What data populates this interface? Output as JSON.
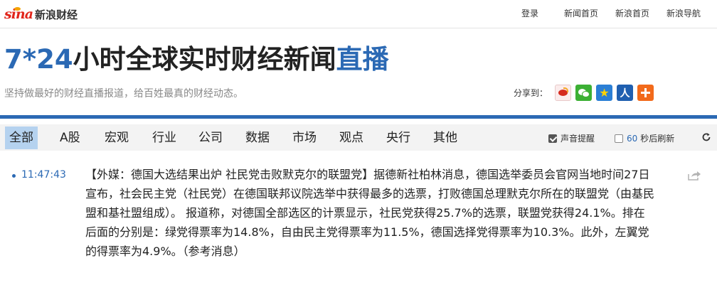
{
  "brand": {
    "logo_text": "sina",
    "name": "新浪财经"
  },
  "top_nav": [
    {
      "label": "登录"
    },
    {
      "label": "新闻首页"
    },
    {
      "label": "新浪首页"
    },
    {
      "label": "新浪导航"
    }
  ],
  "header": {
    "title_prefix": "7*24",
    "title_main": "小时全球实时财经新闻",
    "title_suffix": "直播",
    "slogan": "坚持做最好的财经直播报道，给百姓最真的财经动态。"
  },
  "share": {
    "label": "分享到：",
    "icons": [
      "weibo-icon",
      "wechat-icon",
      "qzone-icon",
      "renren-icon",
      "more-share-icon"
    ]
  },
  "colors": {
    "accent": "#2b69b4",
    "active_tab_bg": "#b5d2ef",
    "brand_red": "#e1251b"
  },
  "categories": [
    {
      "label": "全部",
      "active": true
    },
    {
      "label": "A股"
    },
    {
      "label": "宏观"
    },
    {
      "label": "行业"
    },
    {
      "label": "公司"
    },
    {
      "label": "数据"
    },
    {
      "label": "市场"
    },
    {
      "label": "观点"
    },
    {
      "label": "央行"
    },
    {
      "label": "其他"
    }
  ],
  "controls": {
    "sound_label": "声音提醒",
    "sound_checked": true,
    "refresh_seconds": "60",
    "refresh_label": "秒后刷新",
    "refresh_checked": false
  },
  "feed": [
    {
      "time": "11:47:43",
      "text": "【外媒：德国大选结果出炉 社民党击败默克尔的联盟党】据德新社柏林消息，德国选举委员会官网当地时间27日宣布，社会民主党（社民党）在德国联邦议院选举中获得最多的选票，打败德国总理默克尔所在的联盟党（由基民盟和基社盟组成）。 报道称，对德国全部选区的计票显示，社民党获得25.7%的选票，联盟党获得24.1%。排在后面的分别是：绿党得票率为14.8%，自由民主党得票率为11.5%，德国选择党得票率为10.3%。此外，左翼党的得票率为4.9%。（参考消息）"
    }
  ]
}
